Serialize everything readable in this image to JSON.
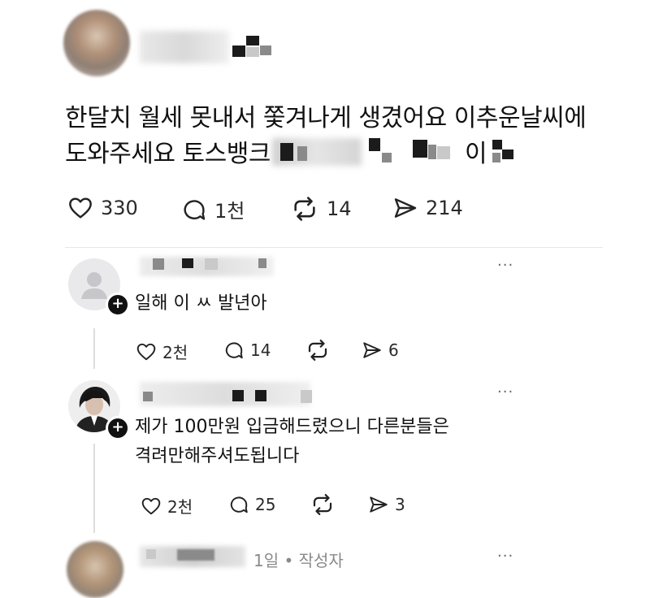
{
  "post": {
    "text_line1": "한달치 월세 못내서 쫓겨나게 생겼어요 이추운날씨에",
    "text_line2_prefix": "도와주세요 토스뱅크",
    "text_line2_suffix": "이",
    "stats": {
      "likes": "330",
      "replies": "1천",
      "reposts": "14",
      "shares": "214"
    }
  },
  "replies": [
    {
      "text": "일해 이 ㅆ 발년아",
      "stats": {
        "likes": "2천",
        "replies": "14",
        "reposts": "",
        "shares": "6"
      }
    },
    {
      "text_line1": "제가 100만원 입금해드렸으니 다른분들은",
      "text_line2": "격려만해주셔도됩니다",
      "stats": {
        "likes": "2천",
        "replies": "25",
        "reposts": "",
        "shares": "3"
      }
    },
    {
      "meta": "1일 • 작성자"
    }
  ],
  "icons": {
    "like": "heart-icon",
    "reply": "comment-icon",
    "repost": "repost-icon",
    "share": "send-icon",
    "more": "more-icon",
    "follow": "plus-icon"
  },
  "more_label": "···"
}
